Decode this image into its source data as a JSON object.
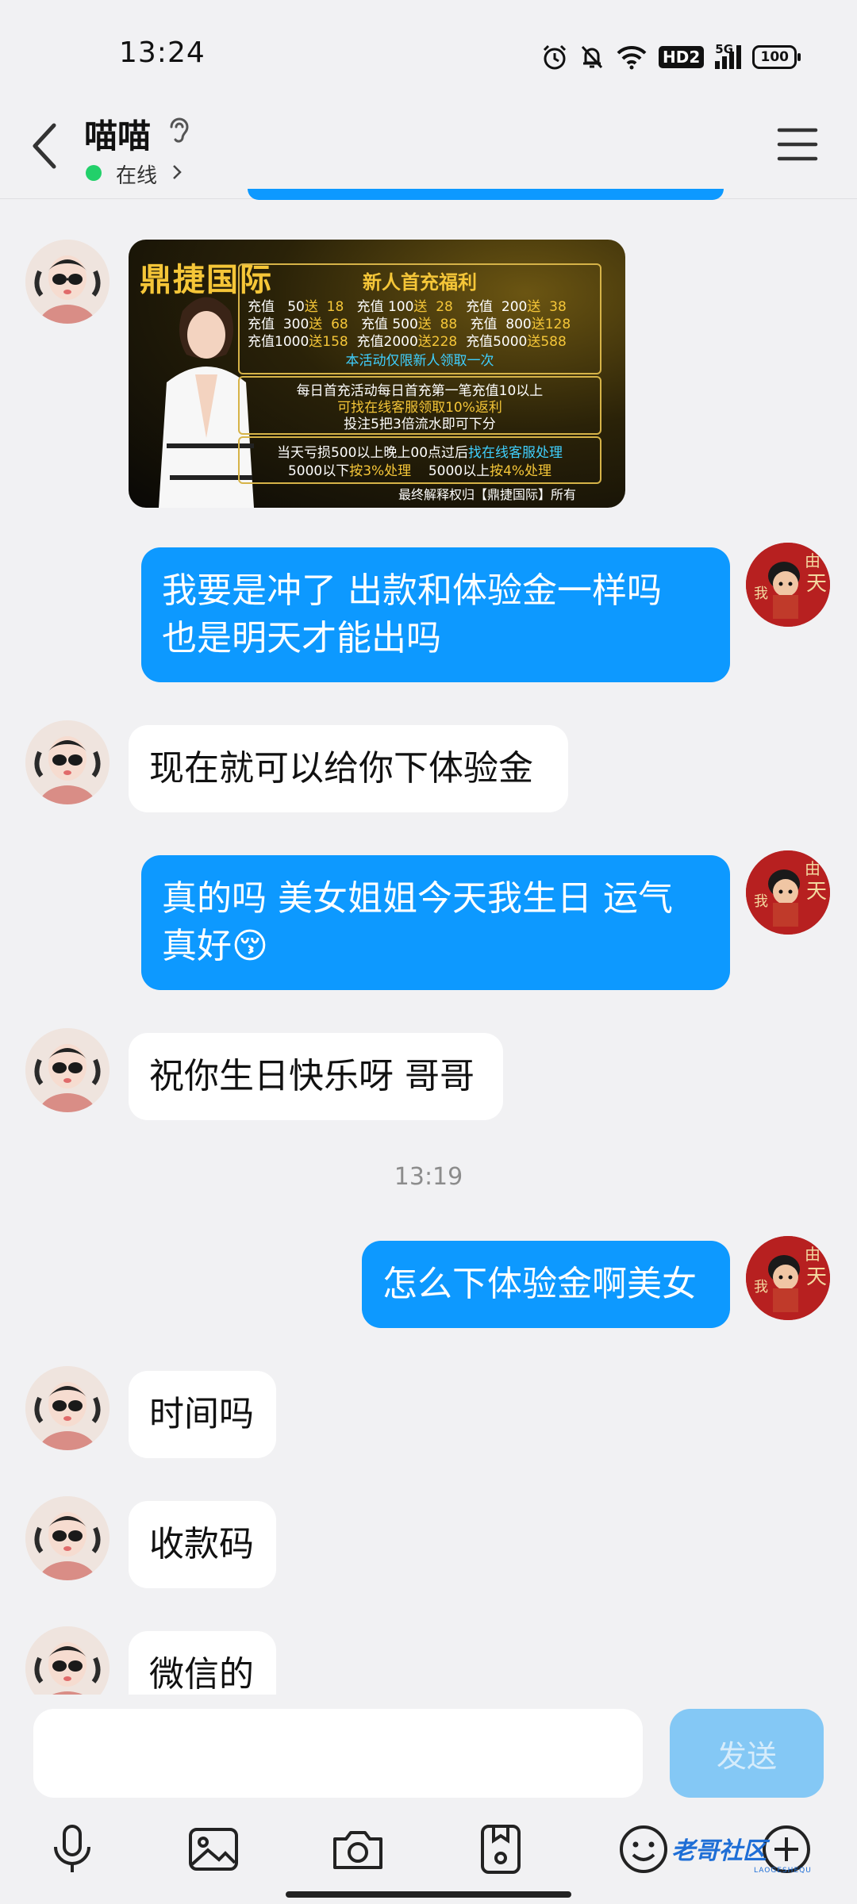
{
  "status_bar": {
    "time": "13:24",
    "signal_label": "5G",
    "hd_label": "HD2",
    "battery": "100",
    "icons": [
      "alarm-icon",
      "bell-off-icon",
      "wifi-icon",
      "hd-icon",
      "signal-icon",
      "battery-icon"
    ]
  },
  "header": {
    "title": "喵喵",
    "status": "在线"
  },
  "ad_image": {
    "brand": "鼎捷国际",
    "title": "新人首充福利",
    "offers": [
      {
        "label": "充值",
        "amount": "50",
        "gift_label": "送",
        "gift": "18"
      },
      {
        "label": "充值",
        "amount": "100",
        "gift_label": "送",
        "gift": "28"
      },
      {
        "label": "充值",
        "amount": "200",
        "gift_label": "送",
        "gift": "38"
      },
      {
        "label": "充值",
        "amount": "300",
        "gift_label": "送",
        "gift": "68"
      },
      {
        "label": "充值",
        "amount": "500",
        "gift_label": "送",
        "gift": "88"
      },
      {
        "label": "充值",
        "amount": "800",
        "gift_label": "送",
        "gift": "128"
      },
      {
        "label": "充值",
        "amount": "1000",
        "gift_label": "送",
        "gift": "158"
      },
      {
        "label": "充值",
        "amount": "2000",
        "gift_label": "送",
        "gift": "228"
      },
      {
        "label": "充值",
        "amount": "5000",
        "gift_label": "送",
        "gift": "588"
      }
    ],
    "once_note": "本活动仅限新人领取一次",
    "daily_line1": "每日首充活动每日首充第一笔充值10以上",
    "daily_line2": "可找在线客服领取10%返利",
    "daily_line3": "投注5把3倍流水即可下分",
    "loss_line1_a": "当天亏损500以上晚上00点过后",
    "loss_line1_b": "找在线客服处理",
    "loss_line2_a": "5000以下",
    "loss_line2_b": "按3%处理",
    "loss_line2_c": "5000以上",
    "loss_line2_d": "按4%处理",
    "footer": "最终解释权归【鼎捷国际】所有"
  },
  "messages": {
    "m1_line1": "我要是冲了 出款和体验金一样吗",
    "m1_line2": "也是明天才能出吗",
    "m2": "现在就可以给你下体验金",
    "m3_line1": "真的吗 美女姐姐今天我生日 运气",
    "m3_line2": "真好😚",
    "m4": "祝你生日快乐呀 哥哥",
    "timestamp": "13:19",
    "m5": "怎么下体验金啊美女",
    "m6": "时间吗",
    "m7": "收款码",
    "m8": "微信的"
  },
  "avatar_right_text": {
    "a": "由",
    "b": "我",
    "c": "天"
  },
  "input": {
    "placeholder": "",
    "send_label": "发送"
  },
  "toolbar": {
    "items": [
      "microphone-icon",
      "image-icon",
      "camera-icon",
      "file-icon",
      "emoji-icon",
      "plus-icon"
    ]
  },
  "watermark": {
    "text": "老哥社区",
    "sub": "LAOGESHEQU"
  },
  "colors": {
    "outgoing_bubble": "#0d99ff",
    "incoming_bubble": "#ffffff",
    "background": "#f1f1f3",
    "online": "#22d06a",
    "send_button": "#84c8f5"
  }
}
